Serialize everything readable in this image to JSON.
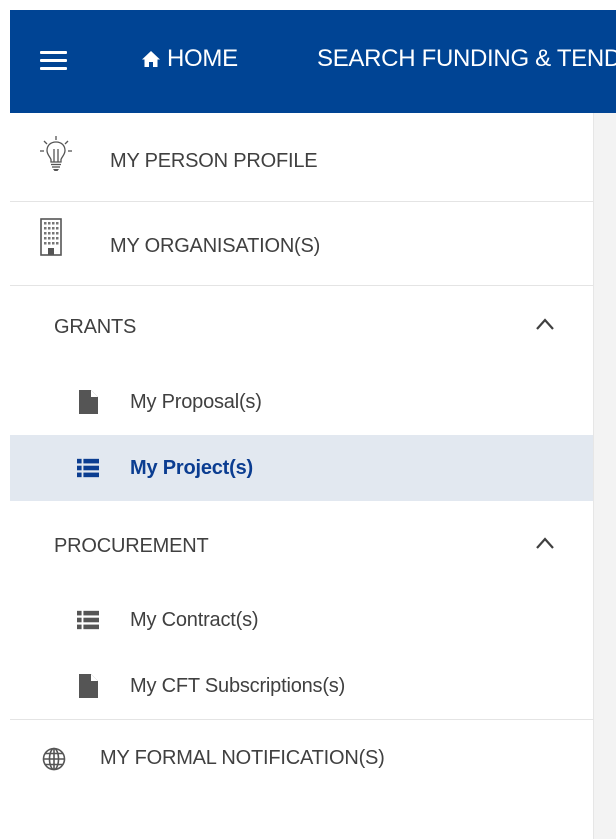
{
  "topbar": {
    "home_label": "HOME",
    "search_label": "SEARCH FUNDING & TENDERS"
  },
  "sidebar": {
    "person_profile": "MY PERSON PROFILE",
    "organisations": "MY ORGANISATION(S)",
    "grants": {
      "header": "GRANTS",
      "items": [
        {
          "label": "My Proposal(s)",
          "icon": "document-icon",
          "active": false
        },
        {
          "label": "My Project(s)",
          "icon": "list-icon",
          "active": true
        }
      ]
    },
    "procurement": {
      "header": "PROCUREMENT",
      "items": [
        {
          "label": "My Contract(s)",
          "icon": "list-icon",
          "active": false
        },
        {
          "label": "My CFT Subscriptions(s)",
          "icon": "document-icon",
          "active": false
        }
      ]
    },
    "formal_notifications": "MY FORMAL NOTIFICATION(S)"
  },
  "colors": {
    "topbar_bg": "#004494",
    "active_bg": "#e2e8f0",
    "active_text": "#0b3d91",
    "text": "#404040"
  }
}
